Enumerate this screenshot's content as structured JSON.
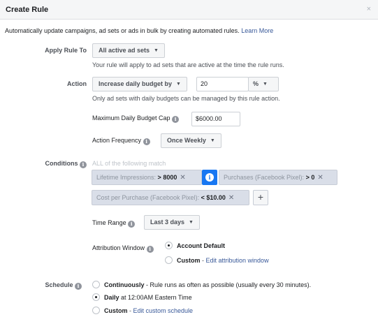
{
  "header": {
    "title": "Create Rule",
    "close": "×"
  },
  "intro": {
    "text": "Automatically update campaigns, ad sets or ads in bulk by creating automated rules.",
    "link": "Learn More"
  },
  "apply_rule": {
    "label": "Apply Rule To",
    "value": "All active ad sets",
    "helper": "Your rule will apply to ad sets that are active at the time the rule runs."
  },
  "action": {
    "label": "Action",
    "value": "Increase daily budget by",
    "amount": "20",
    "unit": "%",
    "helper": "Only ad sets with daily budgets can be managed by this rule action.",
    "cap_label": "Maximum Daily Budget Cap",
    "cap_value": "$6000.00",
    "freq_label": "Action Frequency",
    "freq_value": "Once Weekly"
  },
  "conditions": {
    "label": "Conditions",
    "match": "ALL of the following match",
    "chips": [
      {
        "field": "Lifetime Impressions:",
        "op": ">",
        "value": "8000"
      },
      {
        "field": "Purchases (Facebook Pixel):",
        "op": ">",
        "value": "0"
      },
      {
        "field": "Cost per Purchase (Facebook Pixel):",
        "op": "<",
        "value": "$10.00"
      }
    ],
    "time_range_label": "Time Range",
    "time_range_value": "Last 3 days",
    "attribution_label": "Attribution Window",
    "attribution_options": [
      {
        "label": "Account Default",
        "selected": true
      },
      {
        "label": "Custom",
        "link": "Edit attribution window",
        "selected": false
      }
    ]
  },
  "schedule": {
    "label": "Schedule",
    "options": [
      {
        "label": "Continuously",
        "desc": "- Rule runs as often as possible (usually every 30 minutes).",
        "selected": false
      },
      {
        "label": "Daily",
        "desc": "at 12:00AM Eastern Time",
        "selected": true
      },
      {
        "label": "Custom",
        "link": "Edit custom schedule",
        "selected": false
      }
    ]
  },
  "icons": {
    "info": "info-icon",
    "caret": "caret-down-icon",
    "remove": "close-icon",
    "add": "plus-icon"
  },
  "colors": {
    "accent": "#1877f2",
    "link": "#385898",
    "chip_bg": "#d9dee8"
  }
}
